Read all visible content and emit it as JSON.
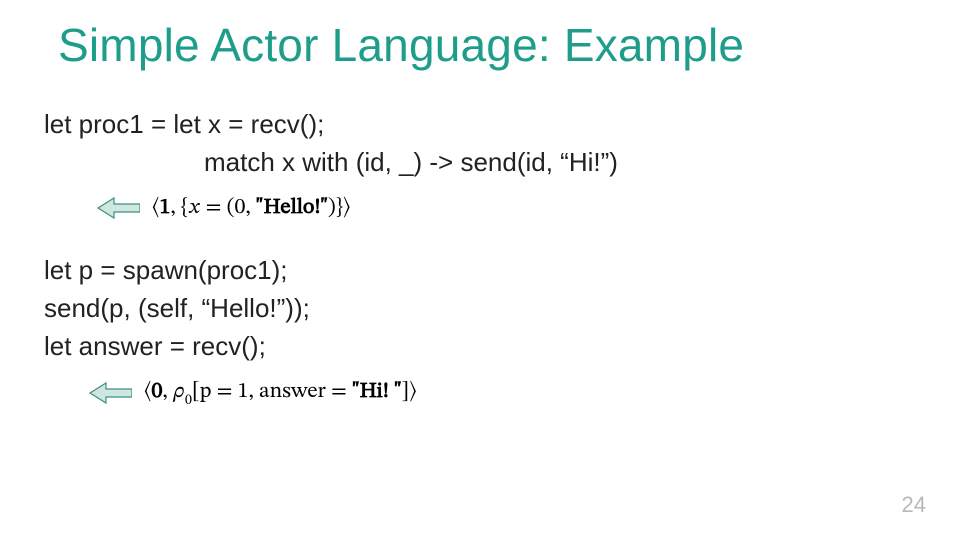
{
  "title": "Simple Actor Language: Example",
  "block1": {
    "line1": "let proc1 = let x = recv();",
    "line2_indent": "match x with (id, _) -> send(id, “Hi!”)"
  },
  "math1": {
    "icon": "left-arrow-icon",
    "expr_open": "⟨",
    "expr_one": "1",
    "expr_comma1": ", {",
    "expr_var": "𝑥",
    "expr_eq": " = (0, ",
    "expr_hello": "\"Hello!\"",
    "expr_close": ")}⟩"
  },
  "block2": {
    "line1": "let p = spawn(proc1);",
    "line2": "send(p, (self, “Hello!”));",
    "line3": "let answer = recv();"
  },
  "math2": {
    "icon": "left-arrow-icon",
    "expr_open": "⟨",
    "expr_zero": "0",
    "expr_rho_lead": ", ",
    "expr_rho": "𝜌",
    "expr_sub0": "0",
    "expr_bracket": "[p = 1, answer = ",
    "expr_hi": "\"Hi! \"",
    "expr_close": "]⟩"
  },
  "page_number": "24",
  "colors": {
    "accent": "#1e9e8a",
    "arrow_fill": "#cfe7e1",
    "arrow_stroke": "#3f8f7f"
  }
}
